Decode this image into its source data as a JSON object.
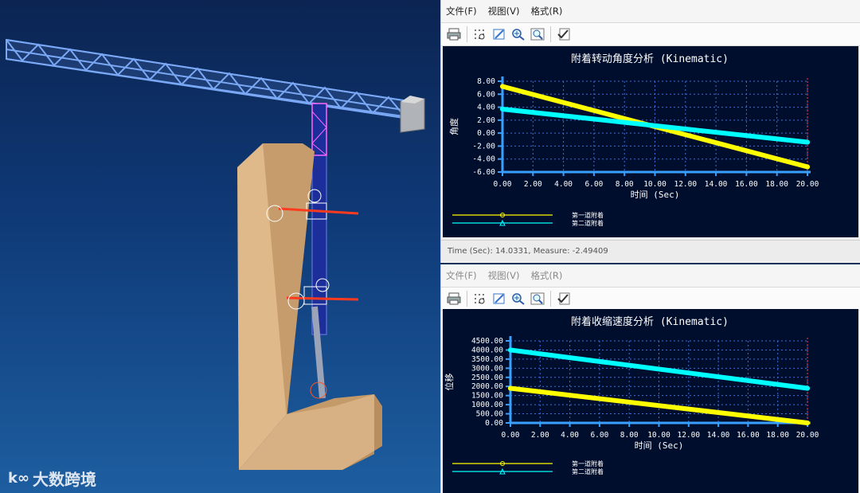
{
  "watermark": {
    "logo": "k∞",
    "text": "大数跨境"
  },
  "top_window": {
    "menu": [
      "文件(F)",
      "视图(V)",
      "格式(R)"
    ],
    "toolbar": [
      "print-icon",
      "grid-icon",
      "pen-icon",
      "zoom-in-icon",
      "zoom-fit-icon",
      "check-edit-icon"
    ],
    "status": "Time (Sec): 14.0331, Measure: -2.49409"
  },
  "bottom_window": {
    "menu": [
      "文件(F)",
      "视图(V)",
      "格式(R)"
    ],
    "toolbar": [
      "print-icon",
      "grid-icon",
      "pen-icon",
      "zoom-in-icon",
      "zoom-fit-icon",
      "check-edit-icon"
    ]
  },
  "colors": {
    "series1": "#ffff00",
    "series2": "#00ffff",
    "axis": "#3aa0ff",
    "grid": "#3b6fd8",
    "plot_bg": "#000e2e"
  },
  "chart_data": [
    {
      "type": "line",
      "title": "附着转动角度分析 (Kinematic)",
      "xlabel": "时间 (Sec)",
      "ylabel": "角度",
      "xlim": [
        0,
        20
      ],
      "ylim": [
        -6,
        8
      ],
      "xticks": [
        "0.00",
        "2.00",
        "4.00",
        "6.00",
        "8.00",
        "10.00",
        "12.00",
        "14.00",
        "16.00",
        "18.00",
        "20.00"
      ],
      "yticks": [
        "8.00",
        "6.00",
        "4.00",
        "2.00",
        "0.00",
        "-2.00",
        "-4.00",
        "-6.00"
      ],
      "grid": true,
      "legend_position": "bottom-left",
      "series": [
        {
          "name": "第一道附着",
          "color": "#ffff00",
          "x": [
            0,
            20
          ],
          "values": [
            7.2,
            -5.2
          ]
        },
        {
          "name": "第二道附着",
          "color": "#00ffff",
          "x": [
            0,
            20
          ],
          "values": [
            3.7,
            -1.4
          ]
        }
      ]
    },
    {
      "type": "line",
      "title": "附着收缩速度分析 (Kinematic)",
      "xlabel": "时间 (Sec)",
      "ylabel": "位移",
      "xlim": [
        0,
        20
      ],
      "ylim": [
        0,
        4500
      ],
      "xticks": [
        "0.00",
        "2.00",
        "4.00",
        "6.00",
        "8.00",
        "10.00",
        "12.00",
        "14.00",
        "16.00",
        "18.00",
        "20.00"
      ],
      "yticks": [
        "4500.00",
        "4000.00",
        "3500.00",
        "3000.00",
        "2500.00",
        "2000.00",
        "1500.00",
        "1000.00",
        "500.00",
        "0.00"
      ],
      "grid": true,
      "legend_position": "bottom-left",
      "series": [
        {
          "name": "第一道附着",
          "color": "#ffff00",
          "x": [
            0,
            20
          ],
          "values": [
            1900,
            0
          ]
        },
        {
          "name": "第二道附着",
          "color": "#00ffff",
          "x": [
            0,
            20
          ],
          "values": [
            4000,
            1900
          ]
        }
      ]
    }
  ]
}
